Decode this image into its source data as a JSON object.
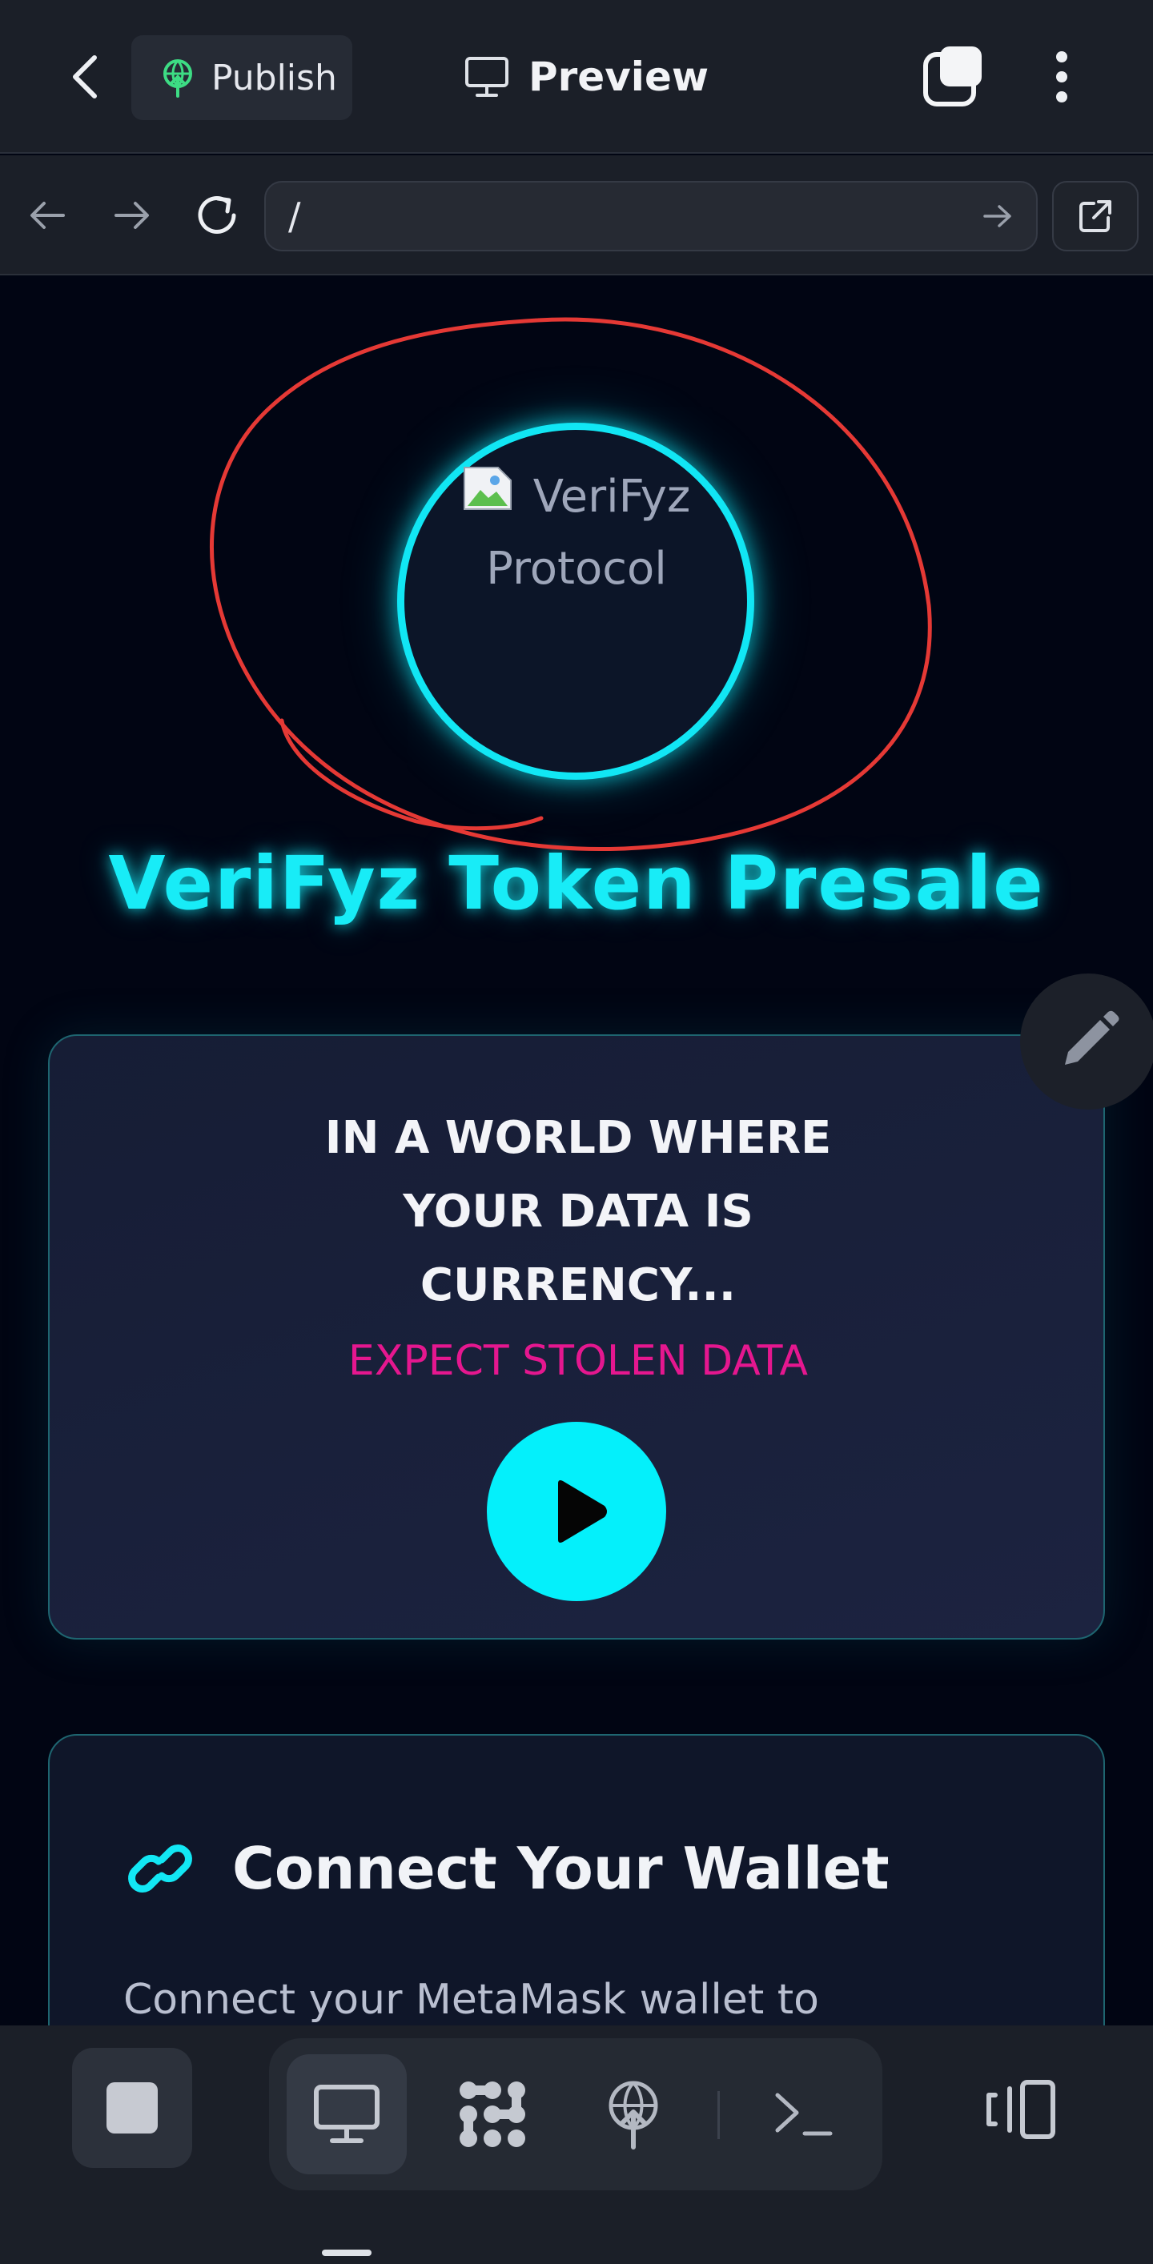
{
  "topbar": {
    "publish_label": "Publish",
    "preview_label": "Preview"
  },
  "urlbar": {
    "url": "/"
  },
  "page": {
    "logo_alt_line1": "VeriFyz",
    "logo_alt_line2": "Protocol",
    "hero_title": "VeriFyz Token Presale",
    "video_card": {
      "headline_lines": [
        "IN A WORLD WHERE",
        "YOUR DATA IS",
        "CURRENCY..."
      ],
      "subheadline": "EXPECT STOLEN DATA"
    },
    "wallet_card": {
      "title": "Connect Your Wallet",
      "description": "Connect your MetaMask wallet to"
    }
  },
  "icons": {
    "back": "chevron-left-icon",
    "publish": "publish-icon",
    "preview": "monitor-icon",
    "tabs": "tabs-icon",
    "menu": "more-vertical-icon",
    "nav_back": "arrow-left-icon",
    "nav_forward": "arrow-right-icon",
    "reload": "reload-icon",
    "go": "arrow-right-icon",
    "open_external": "external-link-icon",
    "edit": "pencil-icon",
    "play": "play-icon",
    "wallet": "link-icon",
    "stop": "stop-icon",
    "desktop": "monitor-icon",
    "integrations": "dots-grid-icon",
    "deploy": "publish-icon",
    "console": "terminal-icon",
    "devices": "devices-icon"
  },
  "colors": {
    "accent_cyan": "#11e6f4",
    "accent_magenta": "#e5178f",
    "annotation_red": "#e53935",
    "background": "#010513"
  }
}
